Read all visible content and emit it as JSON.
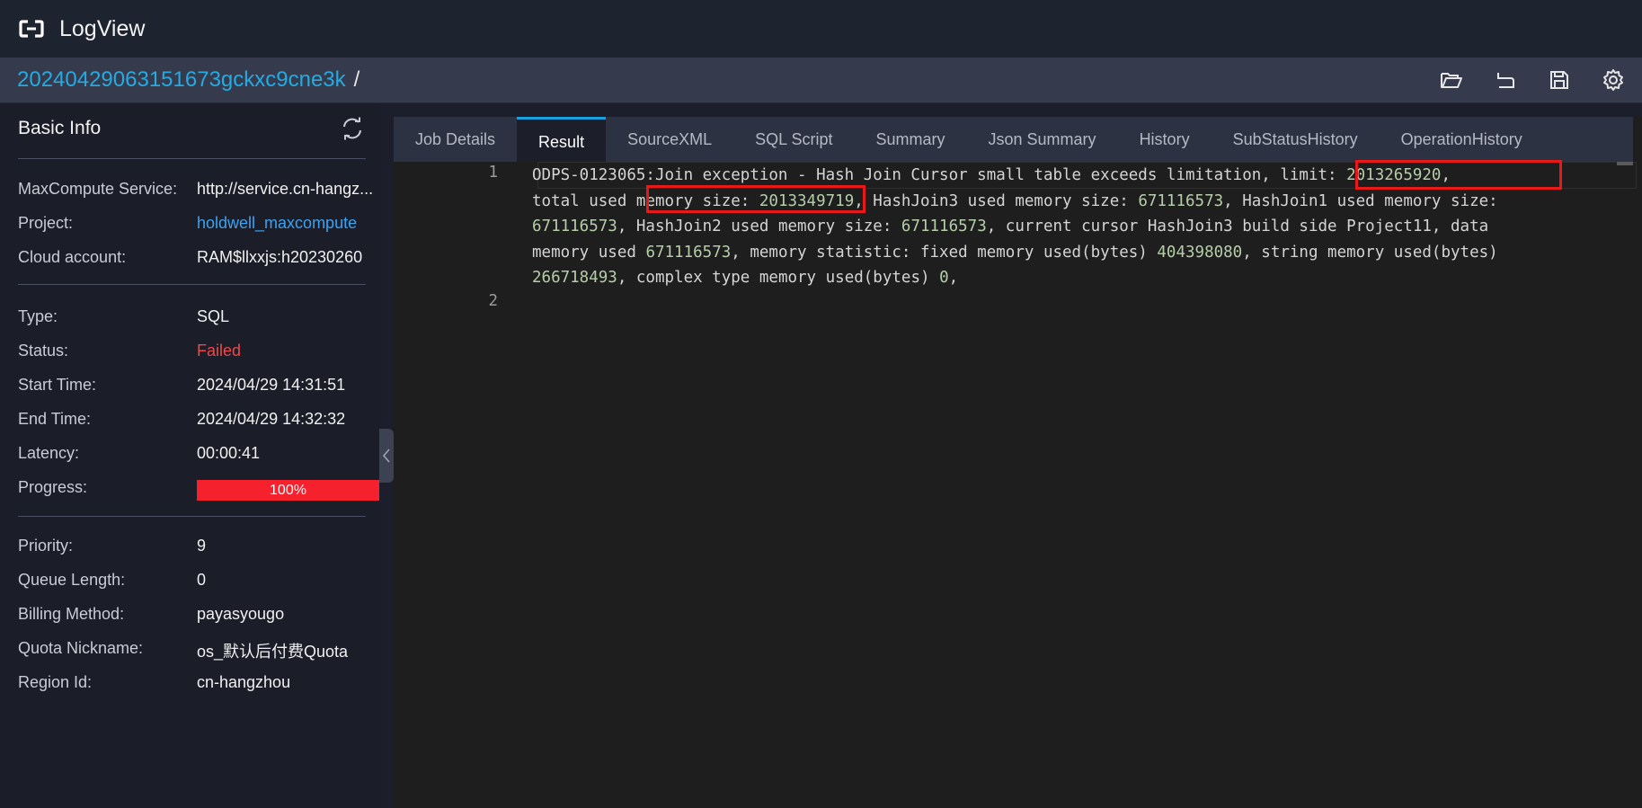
{
  "app": {
    "title": "LogView"
  },
  "job": {
    "id": "20240429063151673gckxc9cne3k",
    "separator": "/"
  },
  "toolbar": {
    "icons": [
      "folder-open-icon",
      "undo-icon",
      "save-icon",
      "gear-icon"
    ]
  },
  "basic_info": {
    "title": "Basic Info",
    "group1": [
      {
        "label": "MaxCompute Service:",
        "value": "http://service.cn-hangz..."
      },
      {
        "label": "Project:",
        "value": "holdwell_maxcompute"
      },
      {
        "label": "Cloud account:",
        "value": "RAM$llxxjs:h20230260"
      }
    ],
    "group2": [
      {
        "label": "Type:",
        "value": "SQL"
      },
      {
        "label": "Status:",
        "value": "Failed"
      },
      {
        "label": "Start Time:",
        "value": "2024/04/29 14:31:51"
      },
      {
        "label": "End Time:",
        "value": "2024/04/29 14:32:32"
      },
      {
        "label": "Latency:",
        "value": "00:00:41"
      },
      {
        "label": "Progress:",
        "value": "100%",
        "progress": 1.0
      }
    ],
    "group3": [
      {
        "label": "Priority:",
        "value": "9"
      },
      {
        "label": "Queue Length:",
        "value": "0"
      },
      {
        "label": "Billing Method:",
        "value": "payasyougo"
      },
      {
        "label": "Quota Nickname:",
        "value": "os_默认后付费Quota"
      },
      {
        "label": "Region Id:",
        "value": "cn-hangzhou"
      }
    ]
  },
  "tabs": [
    "Job Details",
    "Result",
    "SourceXML",
    "SQL Script",
    "Summary",
    "Json Summary",
    "History",
    "SubStatusHistory",
    "OperationHistory"
  ],
  "active_tab": "Result",
  "result": {
    "line_numbers": [
      "1",
      "2"
    ],
    "lines": [
      [
        {
          "t": "ODPS-0123065:Join exception - Hash Join Cursor small table exceeds limitation, "
        },
        {
          "t": "limit: "
        },
        {
          "t": "2013265920",
          "n": true
        },
        {
          "t": ","
        }
      ],
      [
        {
          "t": "total used "
        },
        {
          "t": "memory size: "
        },
        {
          "t": "2013349719",
          "n": true
        },
        {
          "t": ", HashJoin3 used memory size: "
        },
        {
          "t": "671116573",
          "n": true
        },
        {
          "t": ", HashJoin1 used memory size:"
        }
      ],
      [
        {
          "t": "671116573",
          "n": true
        },
        {
          "t": ", HashJoin2 used memory size: "
        },
        {
          "t": "671116573",
          "n": true
        },
        {
          "t": ", current cursor HashJoin3 build side Project11, data"
        }
      ],
      [
        {
          "t": "memory used "
        },
        {
          "t": "671116573",
          "n": true
        },
        {
          "t": ", memory statistic: fixed memory used(bytes) "
        },
        {
          "t": "404398080",
          "n": true
        },
        {
          "t": ", string memory used(bytes)"
        }
      ],
      [
        {
          "t": "266718493",
          "n": true
        },
        {
          "t": ", complex type memory used(bytes) "
        },
        {
          "t": "0",
          "n": true
        },
        {
          "t": ","
        }
      ]
    ]
  },
  "colors": {
    "accent": "#1a9fe0",
    "link": "#27a9e1",
    "failed": "#f04848",
    "progress": "#f5222d",
    "highlight": "#e81919"
  }
}
